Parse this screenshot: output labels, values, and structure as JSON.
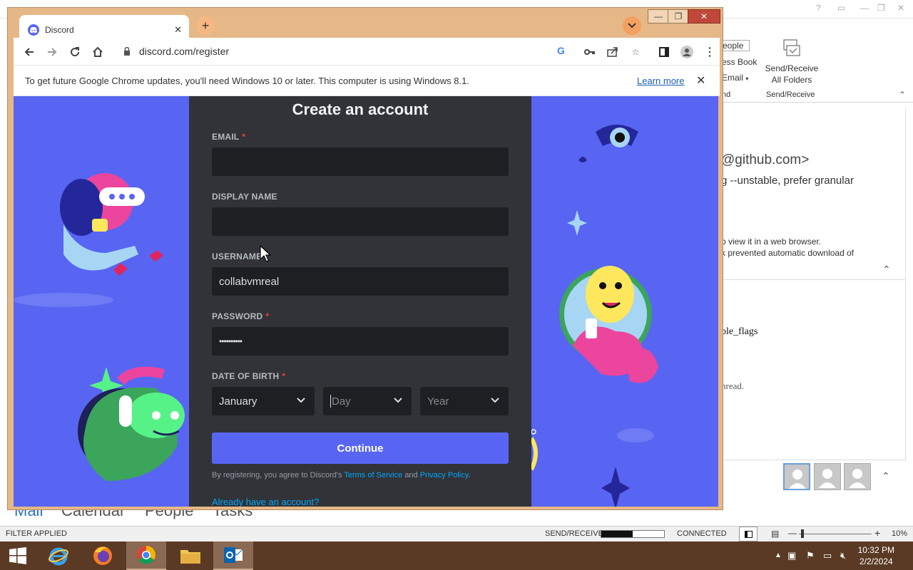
{
  "outlook": {
    "ribbon": {
      "people_frag": "eople",
      "address_book_frag": "ess Book",
      "email_frag": "Email",
      "nd_frag": "nd",
      "send_receive_all": "Send/Receive All Folders",
      "group_label": "Send/Receive"
    },
    "reading": {
      "from_frag": "@github.com>",
      "subject_frag": "g --unstable, prefer granular",
      "line1": "o view it in a web browser.",
      "line2": "k prevented automatic download of",
      "flags_frag": "ble_flags",
      "thread_frag": "hread."
    },
    "nav": {
      "mail": "Mail",
      "calendar": "Calendar",
      "people": "People",
      "tasks": "Tasks"
    },
    "status": {
      "filter": "FILTER APPLIED",
      "send_receive": "SEND/RECEIVE",
      "send_receive_progress": 0.5,
      "connected": "CONNECTED",
      "zoom": "10%"
    }
  },
  "taskbar": {
    "time": "10:32 PM",
    "date": "2/2/2024"
  },
  "chrome": {
    "tab_title": "Discord",
    "url": "discord.com/register",
    "infobar_text": "To get future Google Chrome updates, you'll need Windows 10 or later. This computer is using Windows 8.1.",
    "infobar_link": "Learn more"
  },
  "form": {
    "title": "Create an account",
    "email_label": "EMAIL",
    "display_name_label": "DISPLAY NAME",
    "username_label": "USERNAME",
    "username_value": "collabvmreal",
    "password_label": "PASSWORD",
    "password_value": "••••••••••",
    "dob_label": "DATE OF BIRTH",
    "month_value": "January",
    "day_placeholder": "Day",
    "year_placeholder": "Year",
    "continue": "Continue",
    "terms_prefix": "By registering, you agree to Discord's",
    "terms_link": "Terms of Service",
    "terms_and": "and",
    "privacy_link": "Privacy Policy",
    "terms_suffix": ".",
    "login_link": "Already have an account?",
    "required_mark": "*"
  },
  "colors": {
    "blurple": "#5865f2",
    "form_bg": "#313338",
    "input_bg": "#1e1f22",
    "link": "#00a8fc",
    "chrome_frame": "#e6b888"
  }
}
